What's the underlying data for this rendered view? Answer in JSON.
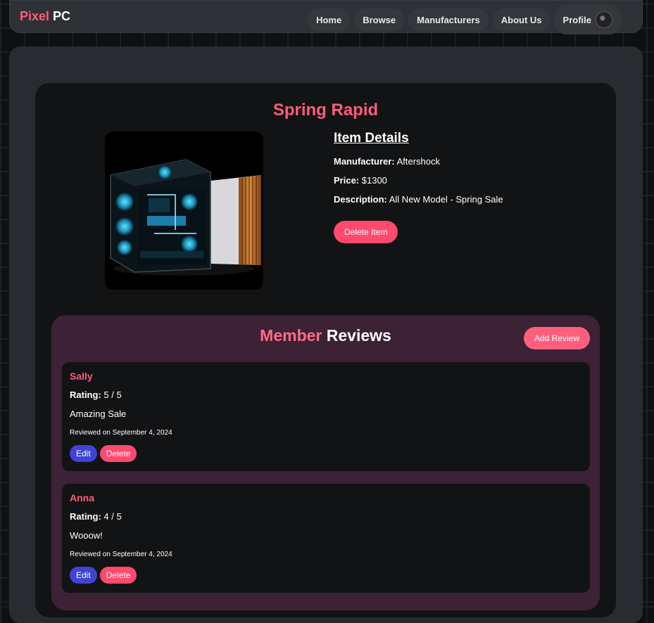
{
  "brand": {
    "part1": "Pixel",
    "part2": "PC"
  },
  "nav": {
    "links": [
      "Home",
      "Browse",
      "Manufacturers",
      "About Us"
    ],
    "profile": "Profile"
  },
  "product": {
    "title": "Spring Rapid",
    "details_heading": "Item Details",
    "manufacturer_label": "Manufacturer:",
    "manufacturer": "Aftershock",
    "price_label": "Price:",
    "price": "$1300",
    "description_label": "Description:",
    "description": "All New Model - Spring Sale",
    "delete_label": "Delete Item"
  },
  "reviews": {
    "title_part1": "Member",
    "title_part2": "Reviews",
    "add_label": "Add Review",
    "rating_label": "Rating:",
    "edit_label": "Edit",
    "delete_label": "Delete",
    "items": [
      {
        "name": "Sally",
        "rating": "5 / 5",
        "text": "Amazing Sale",
        "date": "Reviewed on September 4, 2024"
      },
      {
        "name": "Anna",
        "rating": "4 / 5",
        "text": "Wooow!",
        "date": "Reviewed on September 4, 2024"
      }
    ]
  },
  "colors": {
    "accent": "#ff5c7a",
    "edit": "#3f44d6",
    "reviews_bg": "#3d2135"
  }
}
